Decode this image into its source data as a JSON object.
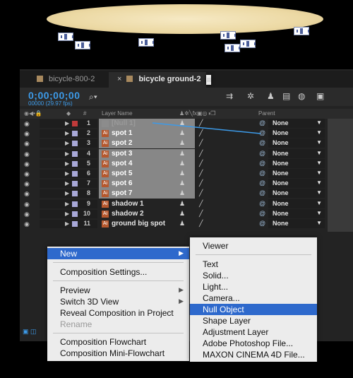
{
  "tabs": [
    {
      "label": "bicycle-800-2",
      "active": false
    },
    {
      "label": "bicycle ground-2",
      "active": true
    }
  ],
  "toolbar": {
    "timecode": "0;00;00;00",
    "fps": "00000 (29.97 fps)",
    "search_icon": "search-icon"
  },
  "header": {
    "layer_name": "Layer Name",
    "hash": "#",
    "parent": "Parent"
  },
  "layers": [
    {
      "num": "1",
      "name": "[Null 1]",
      "color": "#c03a3a",
      "type": "null",
      "parent": "None"
    },
    {
      "num": "2",
      "name": "spot 1",
      "color": "#a8a8d8",
      "type": "ai",
      "parent": "None"
    },
    {
      "num": "3",
      "name": "spot 2",
      "color": "#a8a8d8",
      "type": "ai",
      "parent": "None"
    },
    {
      "num": "4",
      "name": "spot 3",
      "color": "#a8a8d8",
      "type": "ai",
      "parent": "None"
    },
    {
      "num": "5",
      "name": "spot 4",
      "color": "#a8a8d8",
      "type": "ai",
      "parent": "None"
    },
    {
      "num": "6",
      "name": "spot 5",
      "color": "#a8a8d8",
      "type": "ai",
      "parent": "None"
    },
    {
      "num": "7",
      "name": "spot 6",
      "color": "#a8a8d8",
      "type": "ai",
      "parent": "None"
    },
    {
      "num": "8",
      "name": "spot 7",
      "color": "#a8a8d8",
      "type": "ai",
      "parent": "None"
    },
    {
      "num": "9",
      "name": "shadow 1",
      "color": "#a8a8d8",
      "type": "ai",
      "parent": "None"
    },
    {
      "num": "10",
      "name": "shadow 2",
      "color": "#a8a8d8",
      "type": "ai",
      "parent": "None"
    },
    {
      "num": "11",
      "name": "ground big spot",
      "color": "#a8a8d8",
      "type": "ai",
      "parent": "None"
    }
  ],
  "context_menu": {
    "new": "New",
    "composition_settings": "Composition Settings...",
    "preview": "Preview",
    "switch_3d_view": "Switch 3D View",
    "reveal_composition": "Reveal Composition in Project",
    "rename": "Rename",
    "composition_flowchart": "Composition Flowchart",
    "composition_mini_flowchart": "Composition Mini-Flowchart"
  },
  "submenu": {
    "viewer": "Viewer",
    "text": "Text",
    "solid": "Solid...",
    "light": "Light...",
    "camera": "Camera...",
    "null_object": "Null Object",
    "shape_layer": "Shape Layer",
    "adjustment_layer": "Adjustment Layer",
    "photoshop_file": "Adobe Photoshop File...",
    "cinema4d_file": "MAXON CINEMA 4D File..."
  }
}
